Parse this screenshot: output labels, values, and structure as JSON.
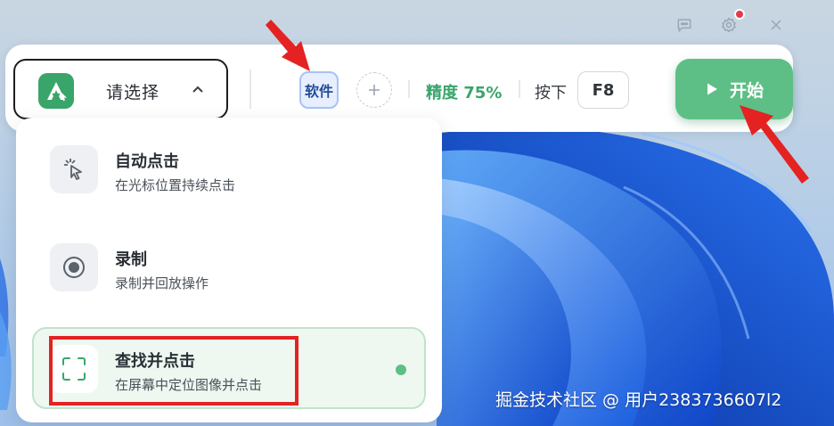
{
  "window": {
    "icons": [
      "chat-icon",
      "gear-icon",
      "close-icon"
    ]
  },
  "selector": {
    "label": "请选择",
    "logo_letter": "A"
  },
  "toolbar": {
    "software_label": "软件",
    "precision_label": "精度 75%",
    "press_label": "按下",
    "hotkey": "F8",
    "start_label": "开始"
  },
  "menu": {
    "items": [
      {
        "title": "自动点击",
        "desc": "在光标位置持续点击",
        "icon": "cursor-click-icon"
      },
      {
        "title": "录制",
        "desc": "录制并回放操作",
        "icon": "record-icon"
      },
      {
        "title": "查找并点击",
        "desc": "在屏幕中定位图像并点击",
        "icon": "scan-frame-icon",
        "selected": true
      }
    ]
  },
  "watermark": "掘金技术社区 @ 用户2383736607l2",
  "colors": {
    "accent_green": "#5ebf86",
    "brand_green": "#3aa56b",
    "annotation_red": "#e42222"
  }
}
